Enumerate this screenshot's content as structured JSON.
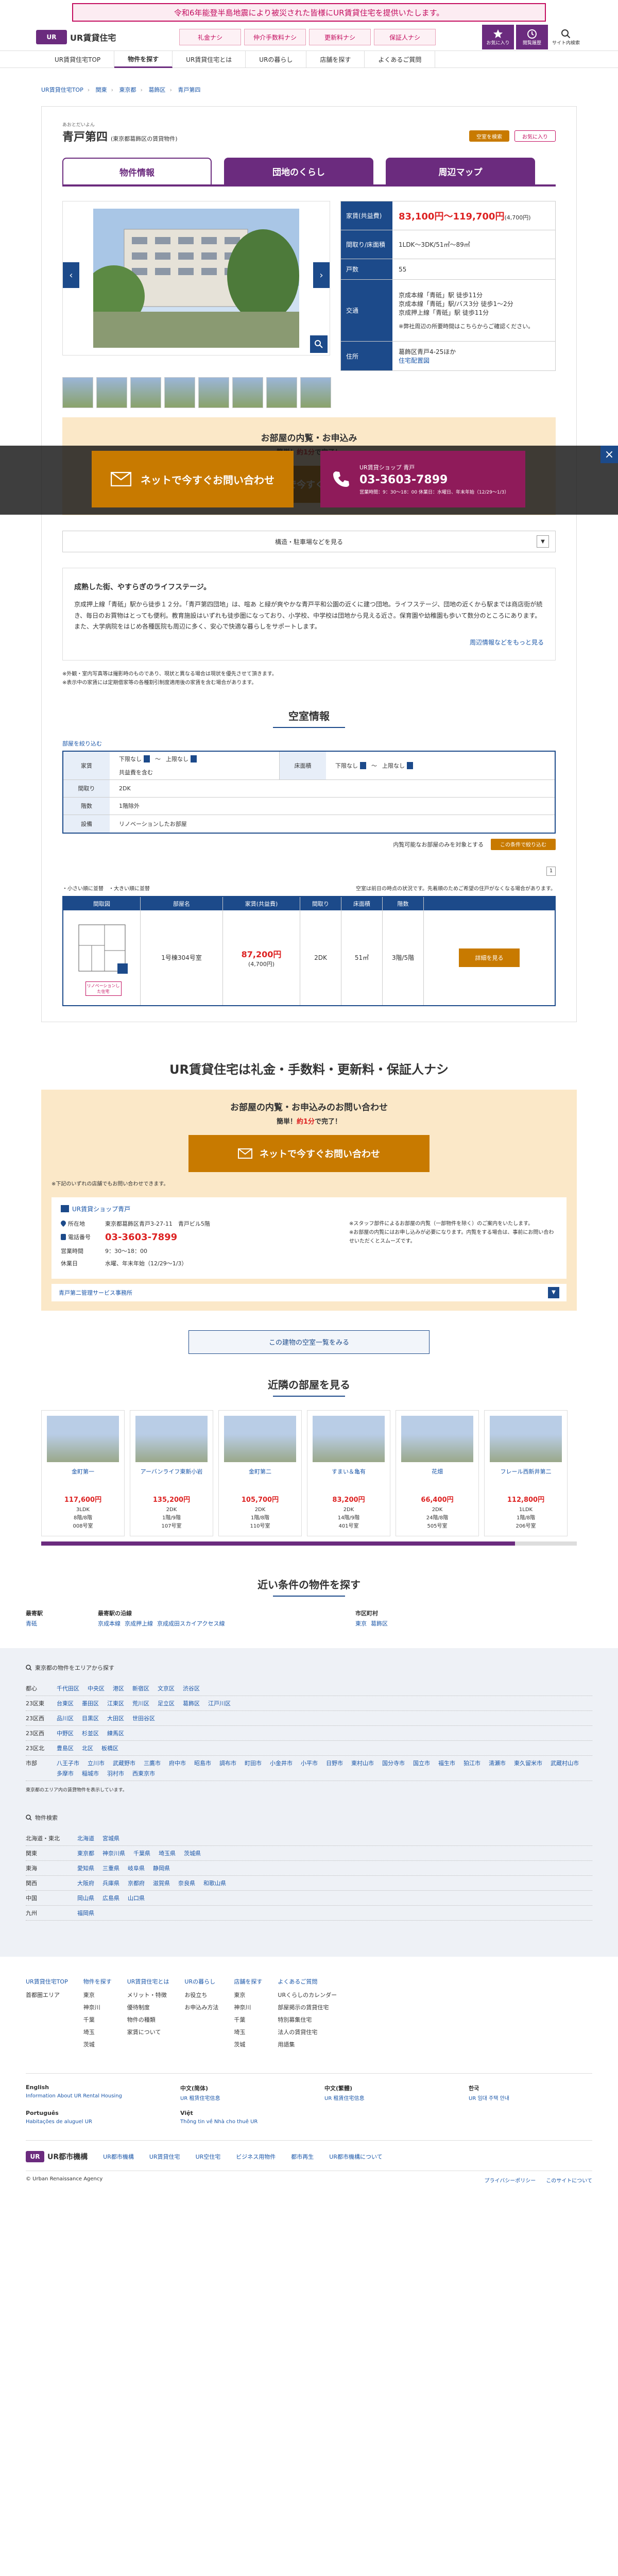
{
  "notice": "令和6年能登半島地震により被災された皆様にUR賃貸住宅を提供いたします。",
  "header": {
    "logo_mark": "UR",
    "logo_text": "UR賃貸住宅",
    "badges": [
      "礼金ナシ",
      "仲介手数料ナシ",
      "更新料ナシ",
      "保証人ナシ"
    ],
    "icons": [
      {
        "label": "お気に入り",
        "icon": "star-icon"
      },
      {
        "label": "閲覧履歴",
        "icon": "clock-icon"
      },
      {
        "label": "サイト内検索",
        "icon": "search-icon"
      }
    ]
  },
  "gnav": [
    "UR賃貸住宅TOP",
    "物件を探す",
    "UR賃貸住宅とは",
    "URの暮らし",
    "店舗を探す",
    "よくあるご質問"
  ],
  "breadcrumb": [
    "UR賃貸住宅TOP",
    "関東",
    "東京都",
    "葛飾区",
    "青戸第四"
  ],
  "property": {
    "ruby": "あおとだいよん",
    "name": "青戸第四",
    "area": "(東京都葛飾区の賃貸物件)",
    "btn_share": "空室を検索",
    "btn_fav": "お気に入り",
    "tabs": [
      "物件情報",
      "団地のくらし",
      "周辺マップ"
    ]
  },
  "spec": {
    "rent_label": "家賃(共益費)",
    "rent": "83,100円〜119,700円",
    "common": "(4,700円)",
    "layout_label": "間取り/床面積",
    "layout": "1LDK〜3DK/51㎡〜89㎡",
    "units_label": "戸数",
    "units": "55",
    "traffic_label": "交通",
    "traffic": [
      "京成本線「青砥」駅 徒歩11分",
      "京成本線「青砥」駅/バス3分 徒歩1〜2分",
      "京成押上線「青砥」駅 徒歩11分"
    ],
    "traffic_note_pre": "※弊社周辺の所要時間はこちら",
    "traffic_note_link": "こちら",
    "traffic_note_post": "からご確認ください。",
    "address_label": "住所",
    "address": "葛飾区青戸4-25ほか",
    "address_link": "地図",
    "address_link2": "住宅配置図"
  },
  "overlay": {
    "btn_web": "ネットで今すぐお問い合わせ",
    "shop_label": "UR賃貸ショップ 青戸",
    "shop_tel": "03-3603-7899",
    "shop_hours": "営業時間：9：30〜18：00 休業日：水曜日、年末年始（12/29〜1/3）"
  },
  "inquiry": {
    "title": "お部屋の内覧・お申込み",
    "sub_pre": "簡単！",
    "sub_em": "約1分",
    "sub_post": "で完了！",
    "btn": "ネットで今すぐお問い合わせ"
  },
  "accordion": "構造・駐車場などを見る",
  "desc": {
    "title": "成熟した街、やすらぎのライフステージ。",
    "body": "京成押上線「青砥」駅から徒歩１２分。「青戸第四団地」は、喧あ と緑が爽やかな青戸平和公園の近くに建つ団地。ライフステージ、団地の近くから駅までは商店街が続き、毎日のお買物はとっても便利。教育施設はいずれも徒歩圏になっており、小学校、中学校は団地から見える近さ。保育園や幼稚園も歩いて数分のところにあります。また、大学病院をはじめ各種医院も周辺に多く、安心で快適な暮らしをサポートします。",
    "link": "周辺情報などをもっと見る",
    "notes": [
      "※外観・室内写真等は撮影時のものであり、現状と異なる場合は現状を優先させて頂きます。",
      "※表示中の家賃には定期借家等の各種割引制度適用後の家賃を含む場合があります。"
    ]
  },
  "vacancy": {
    "title": "空室情報",
    "filter_label": "部屋を絞り込む",
    "rent_k": "家賃",
    "rent_from": "下限なし",
    "rent_to": "上限なし",
    "between": "〜",
    "rent_opt": "共益費を含む",
    "area_k": "床面積",
    "area_from": "下限なし",
    "area_to": "上限なし",
    "madori_k": "間取り",
    "madori": "2DK",
    "floor_k": "階数",
    "floor": "1階除外",
    "facility_k": "設備",
    "facility": "リノベーションしたお部屋",
    "tail_text": "内覧可能なお部屋のみを対象とする",
    "tail_btn": "この条件で絞り込む",
    "page": "1",
    "list_left": "・小さい順に並替　・大きい順に並替",
    "list_right": "空室は前日の時点の状況です。先着順のためご希望の住戸がなくなる場合があります。",
    "cols": [
      "間取図",
      "部屋名",
      "家賃(共益費)",
      "間取り",
      "床面積",
      "階数",
      ""
    ],
    "rows": [
      {
        "name": "1号棟304号室",
        "rent": "87,200円",
        "common": "(4,700円)",
        "madori": "2DK",
        "area": "51㎡",
        "floor": "3階/5階",
        "btn": "詳細を見る",
        "reno": "リノベーションした住宅"
      }
    ]
  },
  "free": {
    "title": "UR賃貸住宅は礼金・手数料・更新料・保証人ナシ",
    "inq_title": "お部屋の内覧・お申込みのお問い合わせ",
    "note": "※下記のいずれの店舗でもお問い合わせできます。",
    "shop_name": "UR賃貸ショップ青戸",
    "addr_k": "所在地",
    "addr": "東京都葛飾区青戸3-27-11　青戸ビル5階",
    "tel_k": "電話番号",
    "tel": "03-3603-7899",
    "hours_k": "営業時間",
    "hours": "9：30〜18：00",
    "closed_k": "休業日",
    "closed": "水曜、年末年始（12/29〜1/3）",
    "right_notes": [
      "※スタッフ部件によるお部屋の内覧（一部物件を除く）のご案内をいたします。",
      "※お部屋の内覧にはお申し込みが必要になります。内覧をする場合は、事前にお問い合わせいただくとスムーズです。"
    ],
    "office": "青戸第二管理サービス事務所"
  },
  "building_btn": "この建物の空室一覧をみる",
  "near": {
    "title": "近隣の部屋を見る",
    "cards": [
      {
        "name": "金町第一",
        "rent": "117,600円",
        "madori": "3LDK",
        "area": "89㎡",
        "floor": "8階/8階",
        "room": "008号室"
      },
      {
        "name": "アーバンライフ東新小岩",
        "rent": "135,200円",
        "madori": "2DK",
        "area": "1階",
        "floor": "1階/9階",
        "room": "107号室"
      },
      {
        "name": "金町第二",
        "rent": "105,700円",
        "madori": "2DK",
        "area": "59㎡",
        "floor": "1階/8階",
        "room": "110号室"
      },
      {
        "name": "すまい＆亀有",
        "rent": "83,200円",
        "madori": "2DK",
        "area": "14階",
        "floor": "14階/9階",
        "room": "401号室"
      },
      {
        "name": "花畑",
        "rent": "66,400円",
        "madori": "2DK",
        "area": "24階",
        "floor": "24階/8階",
        "room": "505号室"
      },
      {
        "name": "フレール西新井第二",
        "rent": "112,800円",
        "madori": "1LDK",
        "area": "1階",
        "floor": "1階/8階",
        "room": "206号室"
      }
    ]
  },
  "cond": {
    "title": "近い条件の物件を探す",
    "cols": [
      {
        "head": "最寄駅",
        "links": [
          "青砥"
        ]
      },
      {
        "head": "最寄駅の沿線",
        "links": [
          "京成本線",
          "京成押上線",
          "京成成田スカイアクセス線"
        ]
      },
      {
        "head": "市区町村",
        "links": [
          "東京",
          "葛飾区"
        ]
      }
    ]
  },
  "fsearch": {
    "area_head": "東京都の物件をエリアから探す",
    "rows": [
      {
        "k": "都心",
        "links": [
          "千代田区",
          "中央区",
          "港区",
          "新宿区",
          "文京区",
          "渋谷区"
        ]
      },
      {
        "k": "23区東",
        "links": [
          "台東区",
          "墨田区",
          "江東区",
          "荒川区",
          "足立区",
          "葛飾区",
          "江戸川区"
        ]
      },
      {
        "k": "23区西",
        "links": [
          "品川区",
          "目黒区",
          "大田区",
          "世田谷区"
        ]
      },
      {
        "k": "23区西",
        "links": [
          "中野区",
          "杉並区",
          "練馬区"
        ]
      },
      {
        "k": "23区北",
        "links": [
          "豊島区",
          "北区",
          "板橋区"
        ]
      },
      {
        "k": "市部",
        "links": [
          "八王子市",
          "立川市",
          "武蔵野市",
          "三鷹市",
          "府中市",
          "昭島市",
          "調布市",
          "町田市",
          "小金井市",
          "小平市",
          "日野市",
          "東村山市",
          "国分寺市",
          "国立市",
          "福生市",
          "狛江市",
          "清瀬市",
          "東久留米市",
          "武蔵村山市",
          "多摩市",
          "稲城市",
          "羽村市",
          "西東京市"
        ]
      }
    ],
    "note": "東京都のエリア内の賃貸物件を表示しています。",
    "pref_head": "物件検索",
    "pref_rows": [
      {
        "k": "北海道・東北",
        "links": [
          "北海道",
          "宮城県"
        ]
      },
      {
        "k": "関東",
        "links": [
          "東京都",
          "神奈川県",
          "千葉県",
          "埼玉県",
          "茨城県"
        ]
      },
      {
        "k": "東海",
        "links": [
          "愛知県",
          "三重県",
          "岐阜県",
          "静岡県"
        ]
      },
      {
        "k": "関西",
        "links": [
          "大阪府",
          "兵庫県",
          "京都府",
          "滋賀県",
          "奈良県",
          "和歌山県"
        ]
      },
      {
        "k": "中国",
        "links": [
          "岡山県",
          "広島県",
          "山口県"
        ]
      },
      {
        "k": "九州",
        "links": [
          "福岡県"
        ]
      }
    ]
  },
  "sitemap": [
    {
      "head": "UR賃貸住宅TOP",
      "items": [
        "首都圏エリア"
      ]
    },
    {
      "head": "物件を探す",
      "items": [
        "東京",
        "神奈川",
        "千葉",
        "埼玉",
        "茨城"
      ]
    },
    {
      "head": "UR賃貸住宅とは",
      "items": [
        "メリット・特徴",
        "優待制度",
        "物件の種類",
        "家賃について"
      ]
    },
    {
      "head": "URの暮らし",
      "items": [
        "お役立ち",
        "お申込み方法"
      ]
    },
    {
      "head": "店舗を探す",
      "items": [
        "東京",
        "神奈川",
        "千葉",
        "埼玉",
        "茨城"
      ]
    },
    {
      "head": "よくあるご質問",
      "items": [
        "URくらしのカレンダー",
        "部屋掲示の賃貸住宅",
        "特別募集住宅",
        "法人の賃貸住宅",
        "用語集"
      ]
    }
  ],
  "langs": [
    {
      "lang": "English",
      "link": "Information About UR Rental Housing"
    },
    {
      "lang": "中文(简体)",
      "link": "UR 租赁住宅信息"
    },
    {
      "lang": "中文(繁體)",
      "link": "UR 租賃住宅信息"
    },
    {
      "lang": "한국",
      "link": "UR 임대 주택 안내"
    },
    {
      "lang": "Português",
      "link": "Habitações de aluguel UR"
    },
    {
      "lang": "Việt",
      "link": "Thông tin về Nhà cho thuê UR"
    }
  ],
  "corp": {
    "logo": "UR都市機構",
    "links": [
      "UR都市機構",
      "UR賃貸住宅",
      "UR空住宅",
      "ビジネス用物件",
      "都市再生",
      "UR都市機構について"
    ]
  },
  "copy": {
    "left": "© Urban Renaissance Agency",
    "links": [
      "プライバシーポリシー",
      "このサイトについて"
    ]
  }
}
